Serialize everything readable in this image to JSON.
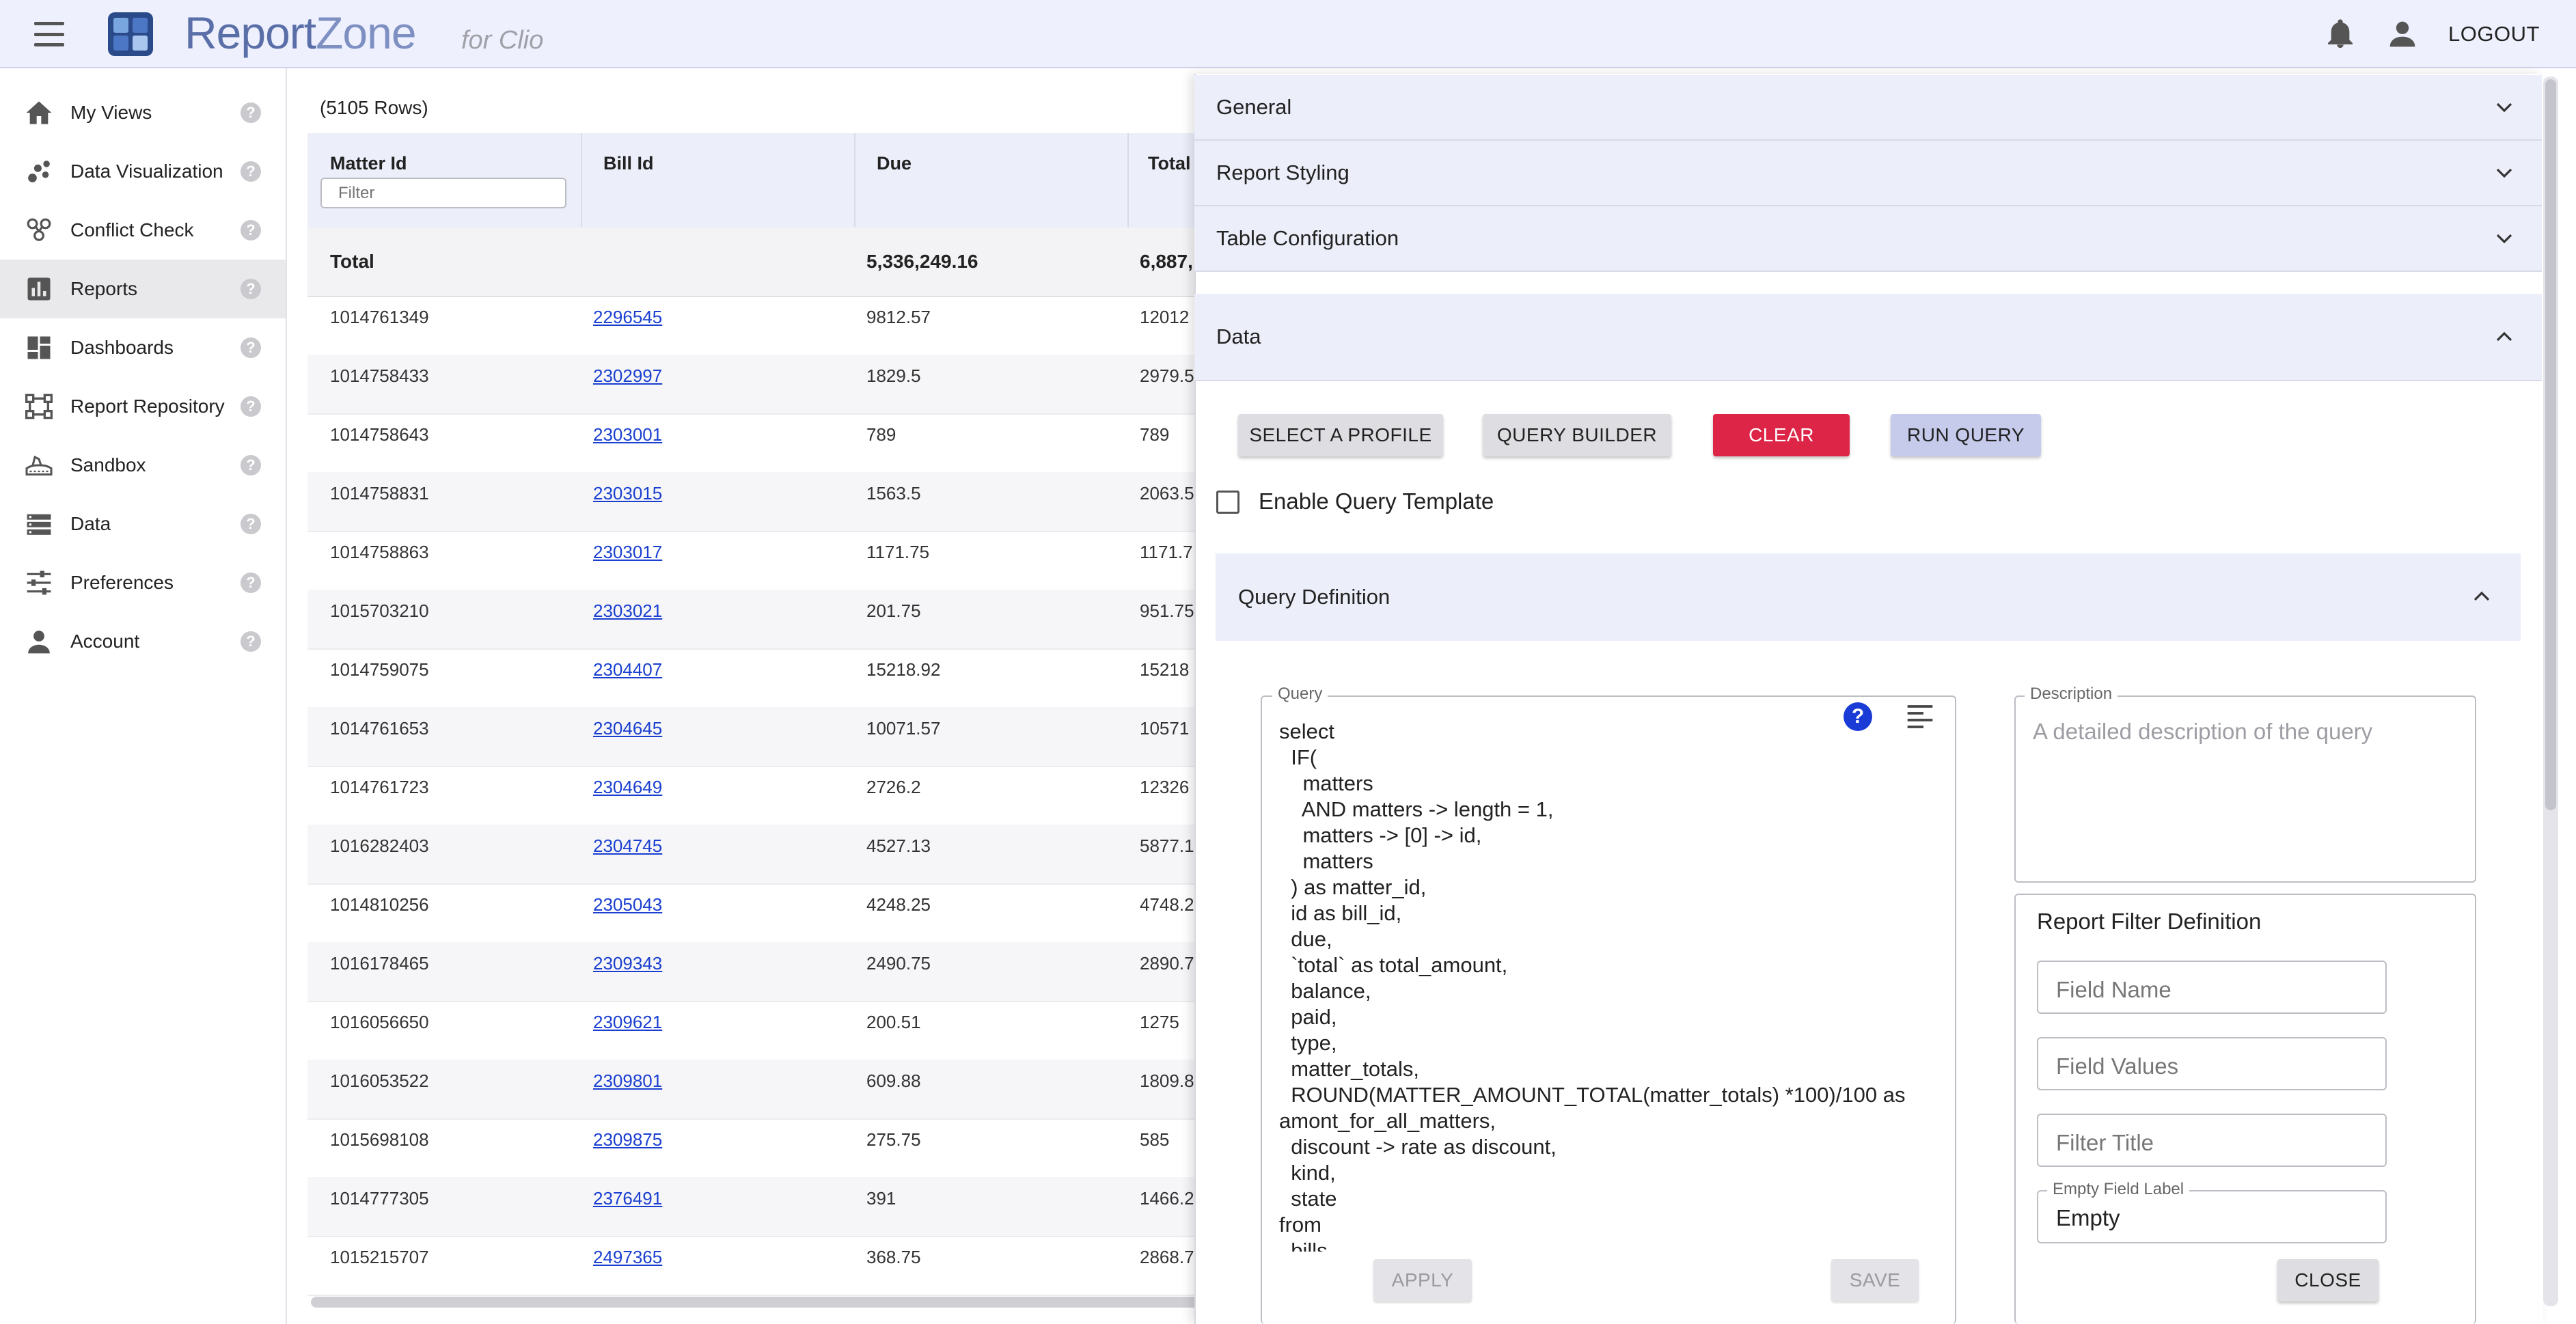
{
  "header": {
    "brand_report": "Report",
    "brand_zone": "Zone",
    "brand_sub": "for Clio",
    "logout": "LOGOUT"
  },
  "sidebar": {
    "items": [
      {
        "label": "My Views",
        "icon": "home-icon"
      },
      {
        "label": "Data Visualization",
        "icon": "scatter-icon"
      },
      {
        "label": "Conflict Check",
        "icon": "conflict-icon"
      },
      {
        "label": "Reports",
        "icon": "bar-chart-icon",
        "active": true
      },
      {
        "label": "Dashboards",
        "icon": "dashboard-icon"
      },
      {
        "label": "Report Repository",
        "icon": "repository-icon"
      },
      {
        "label": "Sandbox",
        "icon": "sandbox-icon"
      },
      {
        "label": "Data",
        "icon": "storage-icon"
      },
      {
        "label": "Preferences",
        "icon": "tune-icon"
      },
      {
        "label": "Account",
        "icon": "person-icon"
      }
    ],
    "help_glyph": "?"
  },
  "table": {
    "row_count": "(5105 Rows)",
    "columns": [
      "Matter Id",
      "Bill Id",
      "Due",
      "Total"
    ],
    "filter_placeholder": "Filter",
    "total_label": "Total",
    "total_due": "5,336,249.16",
    "total_total": "6,887,",
    "rows": [
      [
        "1014761349",
        "2296545",
        "9812.57",
        "12012"
      ],
      [
        "1014758433",
        "2302997",
        "1829.5",
        "2979.5"
      ],
      [
        "1014758643",
        "2303001",
        "789",
        "789"
      ],
      [
        "1014758831",
        "2303015",
        "1563.5",
        "2063.5"
      ],
      [
        "1014758863",
        "2303017",
        "1171.75",
        "1171.7"
      ],
      [
        "1015703210",
        "2303021",
        "201.75",
        "951.75"
      ],
      [
        "1014759075",
        "2304407",
        "15218.92",
        "15218"
      ],
      [
        "1014761653",
        "2304645",
        "10071.57",
        "10571"
      ],
      [
        "1014761723",
        "2304649",
        "2726.2",
        "12326"
      ],
      [
        "1016282403",
        "2304745",
        "4527.13",
        "5877.1"
      ],
      [
        "1014810256",
        "2305043",
        "4248.25",
        "4748.2"
      ],
      [
        "1016178465",
        "2309343",
        "2490.75",
        "2890.7"
      ],
      [
        "1016056650",
        "2309621",
        "200.51",
        "1275"
      ],
      [
        "1016053522",
        "2309801",
        "609.88",
        "1809.8"
      ],
      [
        "1015698108",
        "2309875",
        "275.75",
        "585"
      ],
      [
        "1014777305",
        "2376491",
        "391",
        "1466.2"
      ],
      [
        "1015215707",
        "2497365",
        "368.75",
        "2868.7"
      ]
    ]
  },
  "panel": {
    "sections": [
      "General",
      "Report Styling",
      "Table Configuration"
    ],
    "data_title": "Data",
    "buttons": {
      "select_profile": "SELECT A PROFILE",
      "query_builder": "QUERY BUILDER",
      "clear": "CLEAR",
      "run_query": "RUN QUERY"
    },
    "enable_template": "Enable Query Template",
    "query_definition": "Query Definition",
    "query_label": "Query",
    "query_help": "?",
    "query_text": "select\n  IF(\n    matters\n    AND matters -> length = 1,\n    matters -> [0] -> id,\n    matters\n  ) as matter_id,\n  id as bill_id,\n  due,\n  `total` as total_amount,\n  balance,\n  paid,\n  type,\n  matter_totals,\n  ROUND(MATTER_AMOUNT_TOTAL(matter_totals) *100)/100 as\namont_for_all_matters,\n  discount -> rate as discount,\n  kind,\n  state\nfrom\n  bills",
    "description_label": "Description",
    "description_placeholder": "A detailed description of the query",
    "filter_def": {
      "title": "Report Filter Definition",
      "field_name": "Field Name",
      "field_values": "Field Values",
      "filter_title": "Filter Title",
      "empty_label_legend": "Empty Field Label",
      "empty_label_value": "Empty"
    },
    "footer": {
      "apply": "APPLY",
      "save": "SAVE",
      "close": "CLOSE"
    }
  },
  "colors": {
    "header_bg": "#eef0fd",
    "accent_red": "#dc2547",
    "accent_blue": "#c6cbec",
    "link": "#1a3fd0"
  }
}
